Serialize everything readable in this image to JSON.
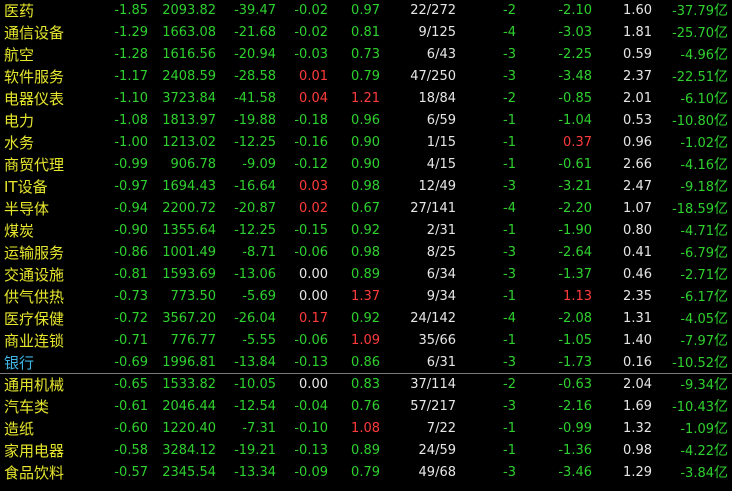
{
  "colors": {
    "down": "#2fd12f",
    "up": "#ff3b3b",
    "neutral": "#e6e6e6",
    "name": "#e6e62e",
    "highlight": "#3fb6e6"
  },
  "unit_suffix": "亿",
  "rows": [
    {
      "name": "医药",
      "chg": "-1.85",
      "price": "2093.82",
      "chgval": "-39.47",
      "spd": "-0.02",
      "ratio": "0.97",
      "updown": "22/272",
      "days": "-2",
      "chg3": "-2.10",
      "turn": "1.60",
      "flow": "-37.79"
    },
    {
      "name": "通信设备",
      "chg": "-1.29",
      "price": "1663.08",
      "chgval": "-21.68",
      "spd": "-0.02",
      "ratio": "0.81",
      "updown": "9/125",
      "days": "-4",
      "chg3": "-3.03",
      "turn": "1.81",
      "flow": "-25.70"
    },
    {
      "name": "航空",
      "chg": "-1.28",
      "price": "1616.56",
      "chgval": "-20.94",
      "spd": "-0.03",
      "ratio": "0.73",
      "updown": "6/43",
      "days": "-3",
      "chg3": "-2.25",
      "turn": "0.59",
      "flow": "-4.96"
    },
    {
      "name": "软件服务",
      "chg": "-1.17",
      "price": "2408.59",
      "chgval": "-28.58",
      "spd": "0.01",
      "ratio": "0.79",
      "updown": "47/250",
      "days": "-3",
      "chg3": "-3.48",
      "turn": "2.37",
      "flow": "-22.51"
    },
    {
      "name": "电器仪表",
      "chg": "-1.10",
      "price": "3723.84",
      "chgval": "-41.58",
      "spd": "0.04",
      "ratio": "1.21",
      "updown": "18/84",
      "days": "-2",
      "chg3": "-0.85",
      "turn": "2.01",
      "flow": "-6.10"
    },
    {
      "name": "电力",
      "chg": "-1.08",
      "price": "1813.97",
      "chgval": "-19.88",
      "spd": "-0.18",
      "ratio": "0.96",
      "updown": "6/59",
      "days": "-1",
      "chg3": "-1.04",
      "turn": "0.53",
      "flow": "-10.80"
    },
    {
      "name": "水务",
      "chg": "-1.00",
      "price": "1213.02",
      "chgval": "-12.25",
      "spd": "-0.16",
      "ratio": "0.90",
      "updown": "1/15",
      "days": "-1",
      "chg3": "0.37",
      "turn": "0.96",
      "flow": "-1.02"
    },
    {
      "name": "商贸代理",
      "chg": "-0.99",
      "price": "906.78",
      "chgval": "-9.09",
      "spd": "-0.12",
      "ratio": "0.90",
      "updown": "4/15",
      "days": "-1",
      "chg3": "-0.61",
      "turn": "2.66",
      "flow": "-4.16"
    },
    {
      "name": "IT设备",
      "chg": "-0.97",
      "price": "1694.43",
      "chgval": "-16.64",
      "spd": "0.03",
      "ratio": "0.98",
      "updown": "12/49",
      "days": "-3",
      "chg3": "-3.21",
      "turn": "2.47",
      "flow": "-9.18"
    },
    {
      "name": "半导体",
      "chg": "-0.94",
      "price": "2200.72",
      "chgval": "-20.87",
      "spd": "0.02",
      "ratio": "0.67",
      "updown": "27/141",
      "days": "-4",
      "chg3": "-2.20",
      "turn": "1.07",
      "flow": "-18.59"
    },
    {
      "name": "煤炭",
      "chg": "-0.90",
      "price": "1355.64",
      "chgval": "-12.25",
      "spd": "-0.15",
      "ratio": "0.92",
      "updown": "2/31",
      "days": "-1",
      "chg3": "-1.90",
      "turn": "0.80",
      "flow": "-4.71"
    },
    {
      "name": "运输服务",
      "chg": "-0.86",
      "price": "1001.49",
      "chgval": "-8.71",
      "spd": "-0.06",
      "ratio": "0.98",
      "updown": "8/25",
      "days": "-3",
      "chg3": "-2.64",
      "turn": "0.41",
      "flow": "-6.79"
    },
    {
      "name": "交通设施",
      "chg": "-0.81",
      "price": "1593.69",
      "chgval": "-13.06",
      "spd": "0.00",
      "ratio": "0.89",
      "updown": "6/34",
      "days": "-3",
      "chg3": "-1.37",
      "turn": "0.46",
      "flow": "-2.71"
    },
    {
      "name": "供气供热",
      "chg": "-0.73",
      "price": "773.50",
      "chgval": "-5.69",
      "spd": "0.00",
      "ratio": "1.37",
      "updown": "9/34",
      "days": "-1",
      "chg3": "1.13",
      "turn": "2.35",
      "flow": "-6.17"
    },
    {
      "name": "医疗保健",
      "chg": "-0.72",
      "price": "3567.20",
      "chgval": "-26.04",
      "spd": "0.17",
      "ratio": "0.92",
      "updown": "24/142",
      "days": "-4",
      "chg3": "-2.08",
      "turn": "1.31",
      "flow": "-4.05"
    },
    {
      "name": "商业连锁",
      "chg": "-0.71",
      "price": "776.77",
      "chgval": "-5.55",
      "spd": "-0.06",
      "ratio": "1.09",
      "updown": "35/66",
      "days": "-1",
      "chg3": "-1.05",
      "turn": "1.40",
      "flow": "-7.97"
    },
    {
      "name": "银行",
      "chg": "-0.69",
      "price": "1996.81",
      "chgval": "-13.84",
      "spd": "-0.13",
      "ratio": "0.86",
      "updown": "6/31",
      "days": "-3",
      "chg3": "-1.73",
      "turn": "0.16",
      "flow": "-10.52",
      "highlight": true,
      "divider": true
    },
    {
      "name": "通用机械",
      "chg": "-0.65",
      "price": "1533.82",
      "chgval": "-10.05",
      "spd": "0.00",
      "ratio": "0.83",
      "updown": "37/114",
      "days": "-2",
      "chg3": "-0.63",
      "turn": "2.04",
      "flow": "-9.34"
    },
    {
      "name": "汽车类",
      "chg": "-0.61",
      "price": "2046.44",
      "chgval": "-12.54",
      "spd": "-0.04",
      "ratio": "0.76",
      "updown": "57/217",
      "days": "-3",
      "chg3": "-2.16",
      "turn": "1.69",
      "flow": "-10.43"
    },
    {
      "name": "造纸",
      "chg": "-0.60",
      "price": "1220.40",
      "chgval": "-7.31",
      "spd": "-0.10",
      "ratio": "1.08",
      "updown": "7/22",
      "days": "-1",
      "chg3": "-0.99",
      "turn": "1.32",
      "flow": "-1.09"
    },
    {
      "name": "家用电器",
      "chg": "-0.58",
      "price": "3284.12",
      "chgval": "-19.21",
      "spd": "-0.13",
      "ratio": "0.89",
      "updown": "24/59",
      "days": "-1",
      "chg3": "-1.36",
      "turn": "0.98",
      "flow": "-4.22"
    },
    {
      "name": "食品饮料",
      "chg": "-0.57",
      "price": "2345.54",
      "chgval": "-13.34",
      "spd": "-0.09",
      "ratio": "0.79",
      "updown": "49/68",
      "days": "-3",
      "chg3": "-3.46",
      "turn": "1.29",
      "flow": "-3.84"
    }
  ]
}
